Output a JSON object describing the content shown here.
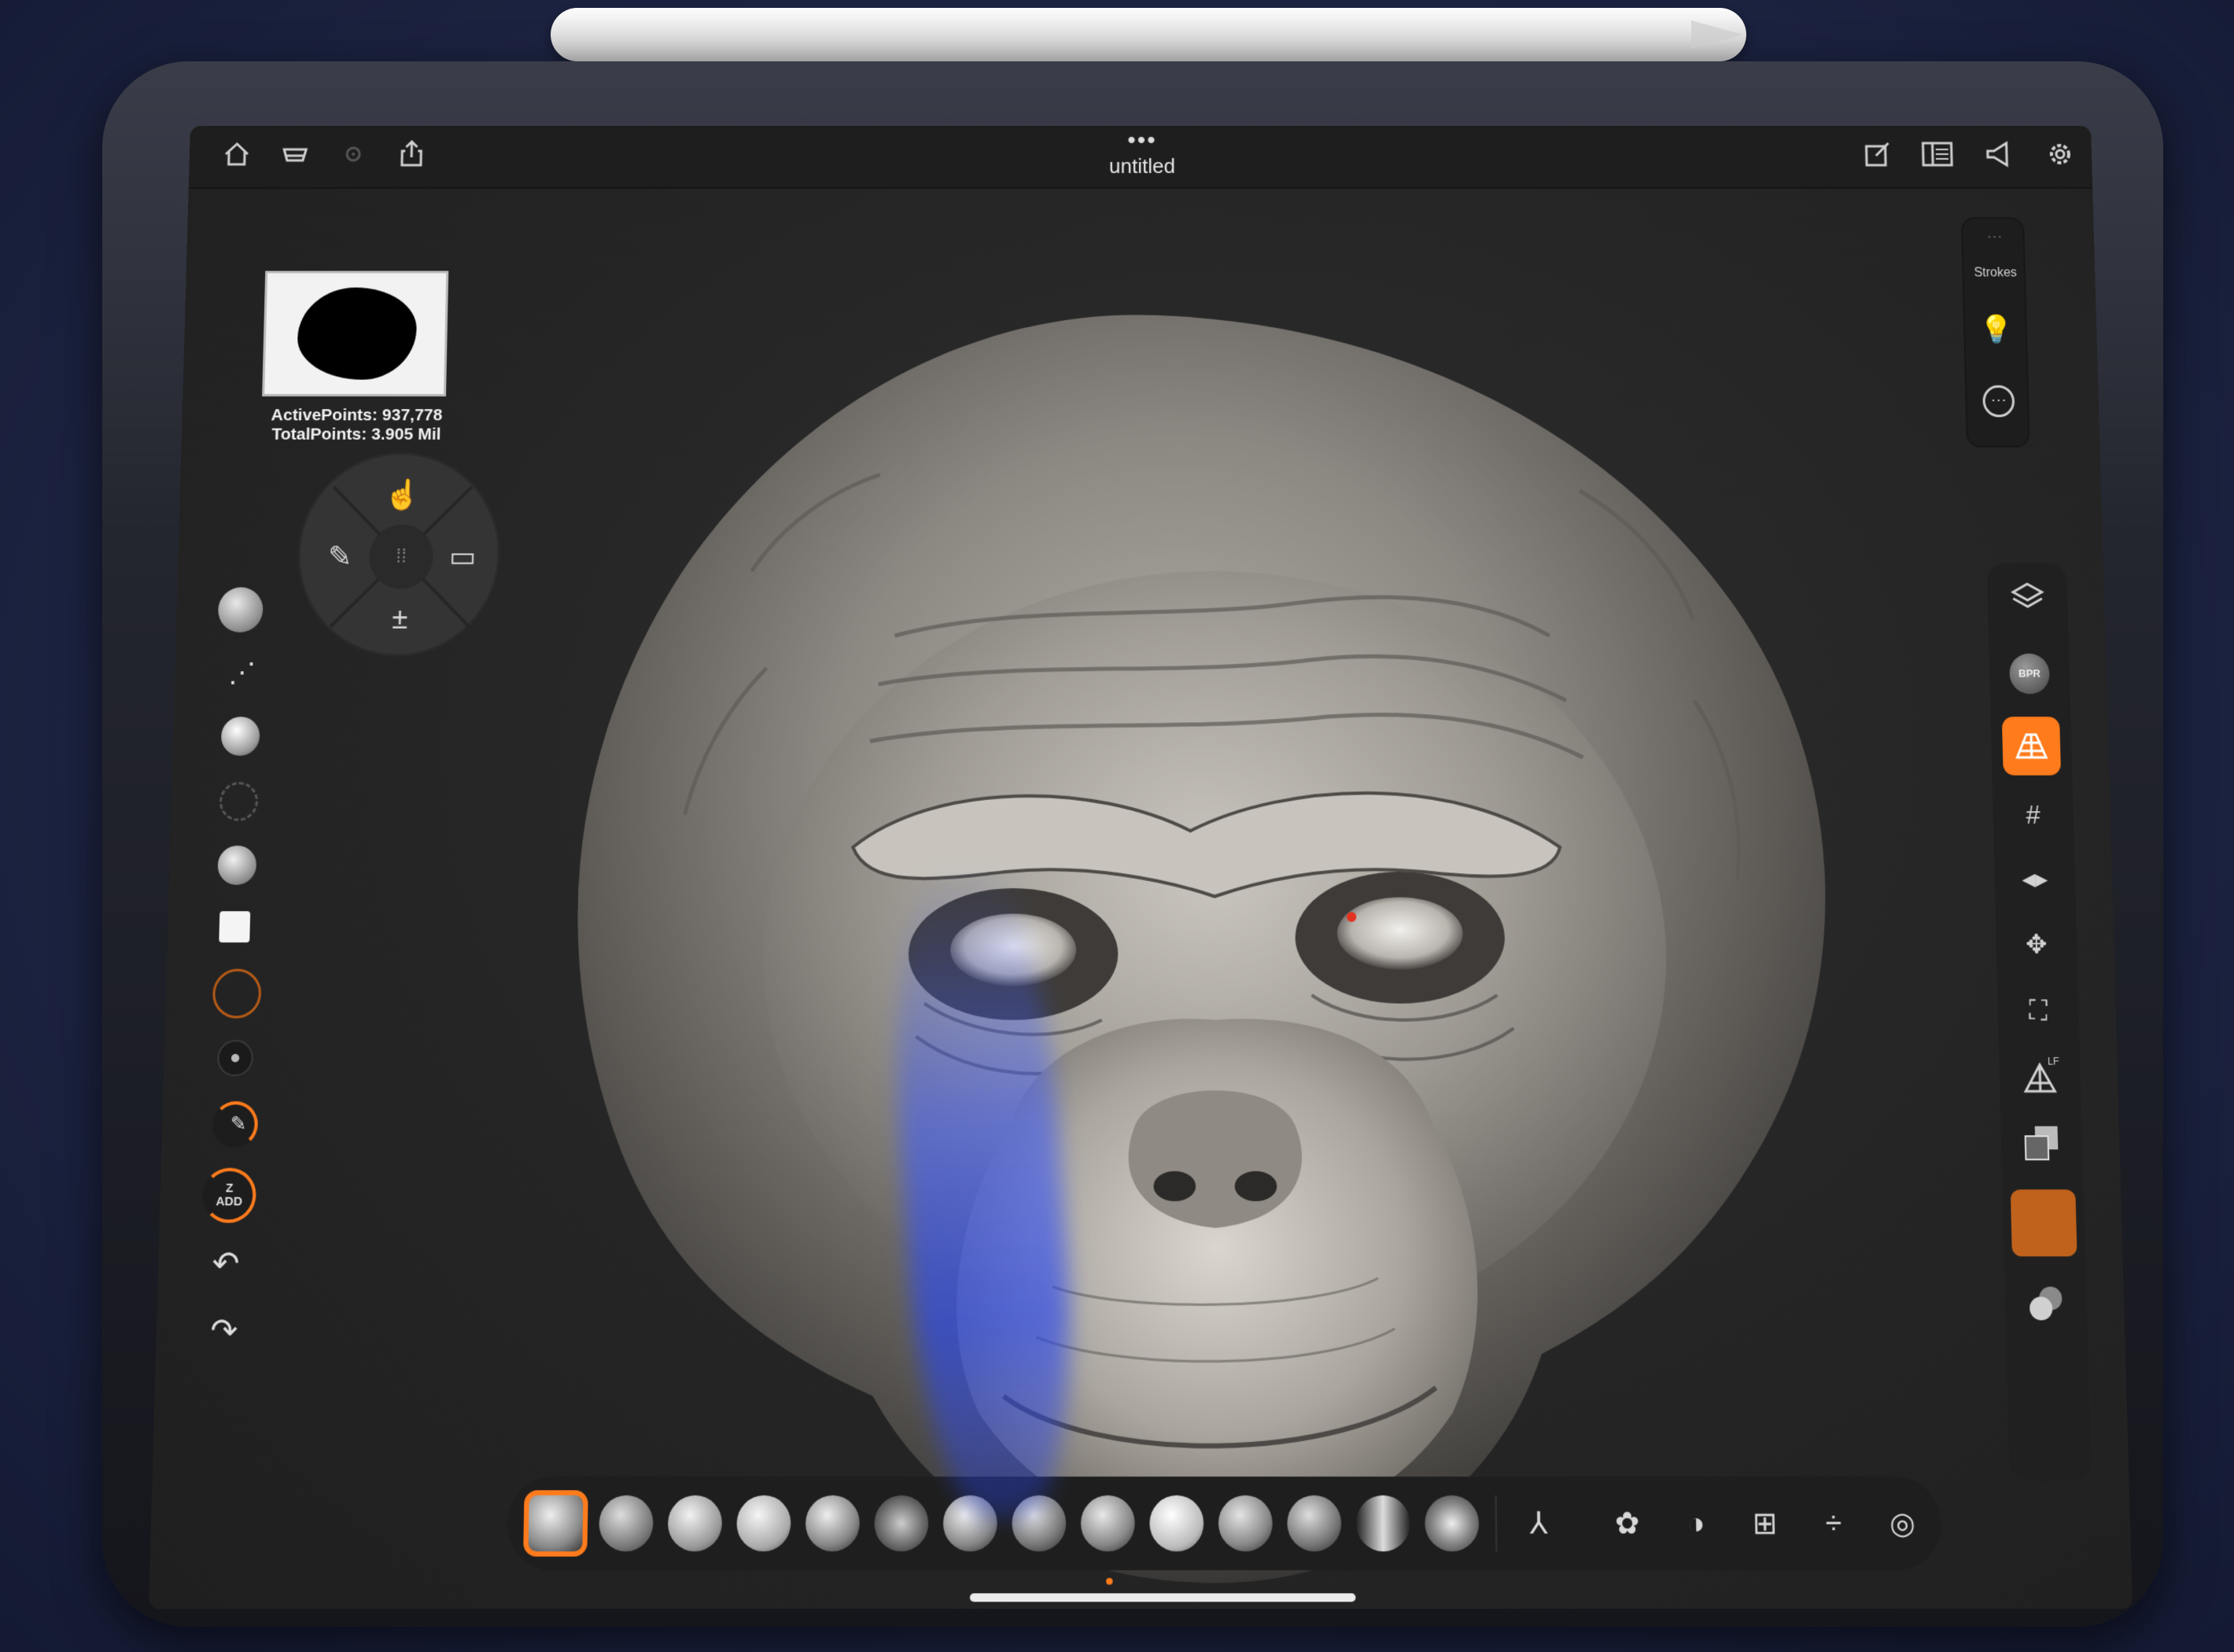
{
  "app": {
    "title": "untitled",
    "menu_dots": "•••"
  },
  "stats": {
    "active_points": "ActivePoints: 937,778",
    "total_points": "TotalPoints: 3.905 Mil"
  },
  "top_left_icons": [
    "home-icon",
    "storage-icon",
    "settings-dim-icon",
    "share-icon"
  ],
  "top_right_icons": [
    "edit-icon",
    "panel-icon",
    "megaphone-icon",
    "gear-icon"
  ],
  "strokes_panel": {
    "label": "Strokes"
  },
  "left_tools": {
    "zadd_label_top": "Z",
    "zadd_label_bottom": "ADD"
  },
  "right_rail": {
    "bpr_label": "BPR",
    "lf_label": "LF"
  },
  "colors": {
    "accent": "#ff7b1c",
    "panel": "#1e1e1e",
    "viewport": "#262626"
  }
}
